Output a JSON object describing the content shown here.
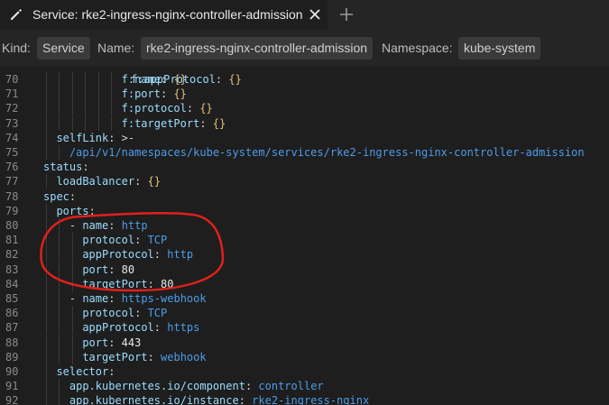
{
  "tab": {
    "title": "Service: rke2-ingress-nginx-controller-admission",
    "edit_icon": "pencil-icon",
    "close_icon": "close-icon",
    "new_tab_icon": "plus-icon"
  },
  "info": {
    "kind_label": "Kind:",
    "kind_value": "Service",
    "name_label": "Name:",
    "name_value": "rke2-ingress-nginx-controller-admission",
    "namespace_label": "Namespace:",
    "namespace_value": "kube-system"
  },
  "colors": {
    "key": "#9cdcfe",
    "value": "#4d9ce8",
    "annotation": "#e0201c"
  },
  "lines": [
    {
      "n": "70",
      "indent": 12,
      "parts": [
        [
          "key",
          "f:name"
        ],
        [
          "punc",
          ": "
        ],
        [
          "brace",
          "{}"
        ]
      ]
    },
    {
      "n": "71",
      "indent": 12,
      "parts": [
        [
          "key",
          "f:port"
        ],
        [
          "punc",
          ": "
        ],
        [
          "brace",
          "{}"
        ]
      ]
    },
    {
      "n": "72",
      "indent": 12,
      "parts": [
        [
          "key",
          "f:protocol"
        ],
        [
          "punc",
          ": "
        ],
        [
          "brace",
          "{}"
        ]
      ]
    },
    {
      "n": "73",
      "indent": 12,
      "parts": [
        [
          "key",
          "f:targetPort"
        ],
        [
          "punc",
          ": "
        ],
        [
          "brace",
          "{}"
        ]
      ]
    },
    {
      "n": "74",
      "indent": 2,
      "parts": [
        [
          "key",
          "selfLink"
        ],
        [
          "punc",
          ": >-"
        ]
      ]
    },
    {
      "n": "75",
      "indent": 4,
      "parts": [
        [
          "val",
          "/api/v1/namespaces/kube-system/services/rke2-ingress-nginx-controller-admission"
        ]
      ]
    },
    {
      "n": "76",
      "indent": 0,
      "parts": [
        [
          "key",
          "status"
        ],
        [
          "punc",
          ":"
        ]
      ]
    },
    {
      "n": "77",
      "indent": 2,
      "parts": [
        [
          "key",
          "loadBalancer"
        ],
        [
          "punc",
          ": "
        ],
        [
          "brace",
          "{}"
        ]
      ]
    },
    {
      "n": "78",
      "indent": 0,
      "parts": [
        [
          "key",
          "spec"
        ],
        [
          "punc",
          ":"
        ]
      ]
    },
    {
      "n": "79",
      "indent": 2,
      "parts": [
        [
          "key",
          "ports"
        ],
        [
          "punc",
          ":"
        ]
      ]
    },
    {
      "n": "80",
      "indent": 4,
      "parts": [
        [
          "punc",
          "- "
        ],
        [
          "key",
          "name"
        ],
        [
          "punc",
          ": "
        ],
        [
          "val",
          "http"
        ]
      ]
    },
    {
      "n": "81",
      "indent": 6,
      "parts": [
        [
          "key",
          "protocol"
        ],
        [
          "punc",
          ": "
        ],
        [
          "val",
          "TCP"
        ]
      ]
    },
    {
      "n": "82",
      "indent": 6,
      "parts": [
        [
          "key",
          "appProtocol"
        ],
        [
          "punc",
          ": "
        ],
        [
          "val",
          "http"
        ]
      ]
    },
    {
      "n": "83",
      "indent": 6,
      "parts": [
        [
          "key",
          "port"
        ],
        [
          "punc",
          ": "
        ],
        [
          "num",
          "80"
        ]
      ]
    },
    {
      "n": "84",
      "indent": 6,
      "parts": [
        [
          "key",
          "targetPort"
        ],
        [
          "punc",
          ": "
        ],
        [
          "num",
          "80"
        ]
      ]
    },
    {
      "n": "85",
      "indent": 4,
      "parts": [
        [
          "punc",
          "- "
        ],
        [
          "key",
          "name"
        ],
        [
          "punc",
          ": "
        ],
        [
          "val",
          "https-webhook"
        ]
      ]
    },
    {
      "n": "86",
      "indent": 6,
      "parts": [
        [
          "key",
          "protocol"
        ],
        [
          "punc",
          ": "
        ],
        [
          "val",
          "TCP"
        ]
      ]
    },
    {
      "n": "87",
      "indent": 6,
      "parts": [
        [
          "key",
          "appProtocol"
        ],
        [
          "punc",
          ": "
        ],
        [
          "val",
          "https"
        ]
      ]
    },
    {
      "n": "88",
      "indent": 6,
      "parts": [
        [
          "key",
          "port"
        ],
        [
          "punc",
          ": "
        ],
        [
          "num",
          "443"
        ]
      ]
    },
    {
      "n": "89",
      "indent": 6,
      "parts": [
        [
          "key",
          "targetPort"
        ],
        [
          "punc",
          ": "
        ],
        [
          "val",
          "webhook"
        ]
      ]
    },
    {
      "n": "90",
      "indent": 2,
      "parts": [
        [
          "key",
          "selector"
        ],
        [
          "punc",
          ":"
        ]
      ]
    },
    {
      "n": "91",
      "indent": 4,
      "parts": [
        [
          "key",
          "app.kubernetes.io/component"
        ],
        [
          "punc",
          ": "
        ],
        [
          "val",
          "controller"
        ]
      ]
    },
    {
      "n": "92",
      "indent": 4,
      "parts": [
        [
          "key",
          "app.kubernetes.io/instance"
        ],
        [
          "punc",
          ": "
        ],
        [
          "val",
          "rke2-ingress-nginx"
        ]
      ]
    }
  ]
}
